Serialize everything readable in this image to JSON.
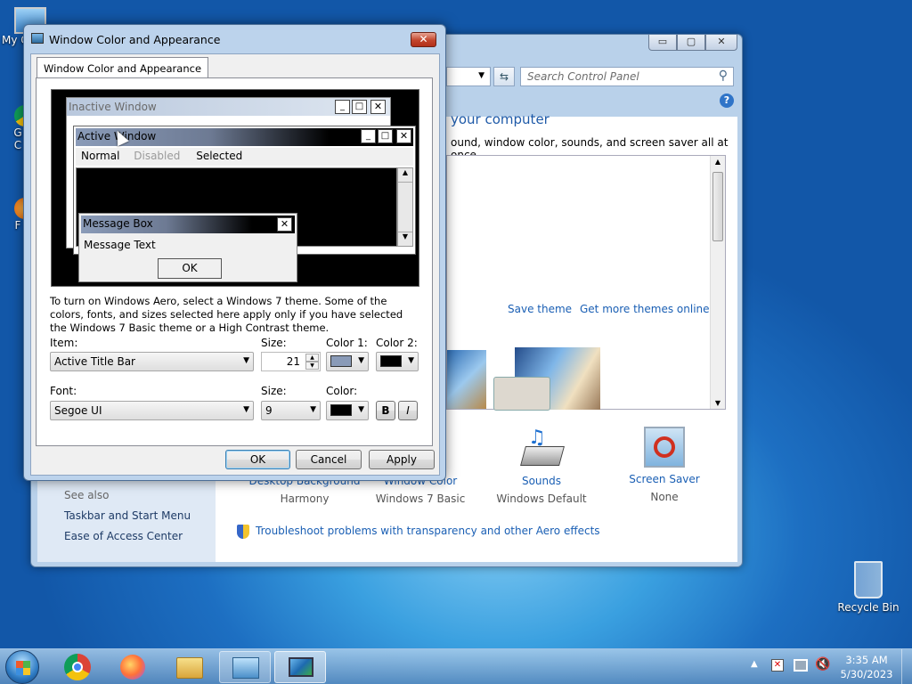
{
  "desktop": {
    "icons": [
      {
        "label": "My C"
      },
      {
        "label": "G\nC"
      },
      {
        "label": "F"
      },
      {
        "label": "Recycle Bin"
      }
    ]
  },
  "control_panel": {
    "search_placeholder": "Search Control Panel",
    "heading": "your computer",
    "description": "ound, window color, sounds, and screen saver all at once.",
    "save_theme": "Save theme",
    "more_themes": "Get more themes online",
    "see_also": "See also",
    "links": [
      "Taskbar and Start Menu",
      "Ease of Access Center"
    ],
    "items": [
      {
        "title": "Desktop Background",
        "value": "Harmony"
      },
      {
        "title": "Window Color",
        "value": "Windows 7 Basic"
      },
      {
        "title": "Sounds",
        "value": "Windows Default"
      },
      {
        "title": "Screen Saver",
        "value": "None"
      }
    ],
    "troubleshoot": "Troubleshoot problems with transparency and other Aero effects"
  },
  "dialog": {
    "title": "Window Color and Appearance",
    "tab": "Window Color and Appearance",
    "preview": {
      "inactive": "Inactive Window",
      "active": "Active Window",
      "menu": [
        "Normal",
        "Disabled",
        "Selected"
      ],
      "message_box": "Message Box",
      "message_text": "Message Text",
      "ok": "OK"
    },
    "info": "To turn on Windows Aero, select a Windows 7 theme.  Some of the colors, fonts, and sizes selected here apply only if you have selected the Windows 7 Basic theme or a High Contrast theme.",
    "item_label": "Item:",
    "item_value": "Active Title Bar",
    "size_label": "Size:",
    "size_value": "21",
    "color1_label": "Color 1:",
    "color2_label": "Color 2:",
    "font_label": "Font:",
    "font_value": "Segoe UI",
    "font_size_label": "Size:",
    "font_size_value": "9",
    "color_label": "Color:",
    "bold": "B",
    "italic": "I",
    "ok": "OK",
    "cancel": "Cancel",
    "apply": "Apply",
    "colors": {
      "color1": "#8a9bb8",
      "color2": "#000000",
      "font_color": "#000000"
    }
  },
  "taskbar": {
    "time": "3:35 AM",
    "date": "5/30/2023"
  }
}
